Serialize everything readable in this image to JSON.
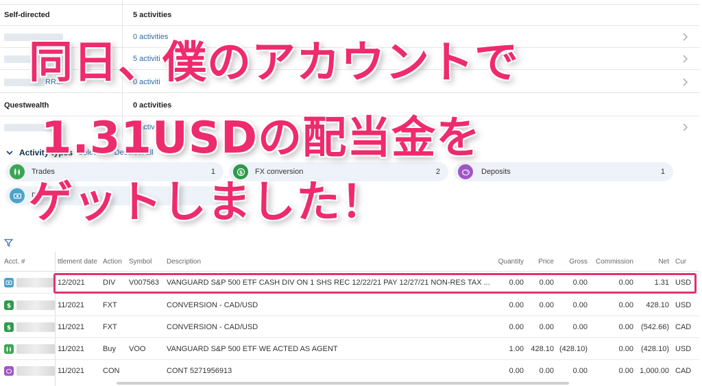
{
  "accounts": {
    "groups": [
      {
        "name": "Self-directed",
        "summary": "5 activities"
      },
      {
        "name": "Questwealth",
        "summary": "0 activities"
      }
    ],
    "sub_rows": [
      {
        "label_suffix": "",
        "summary": "0 activities"
      },
      {
        "label_suffix": "",
        "summary": "5 activiti"
      },
      {
        "label_suffix": "RRSP",
        "summary": "0 activiti"
      },
      {
        "label_suffix": "",
        "summary": "0 activiti"
      }
    ]
  },
  "activity_types": {
    "title": "Activity types",
    "select_all": "Select all",
    "deselect_all": "Deselect all",
    "chips": [
      {
        "label": "Trades",
        "count": "1",
        "icon": "candlestick-icon",
        "color": "#3aa655"
      },
      {
        "label": "FX conversion",
        "count": "2",
        "icon": "dollar-exchange-icon",
        "color": "#2e9a4a"
      },
      {
        "label": "Deposits",
        "count": "1",
        "icon": "piggy-bank-icon",
        "color": "#a056c5"
      },
      {
        "label": "D",
        "count": "",
        "icon": "dividend-icon",
        "color": "#4ba3c9"
      }
    ]
  },
  "table": {
    "columns": {
      "acct": "Acct. #",
      "settlement": "ttlement date",
      "action": "Action",
      "symbol": "Symbol",
      "description": "Description",
      "quantity": "Quantity",
      "price": "Price",
      "gross": "Gross",
      "commission": "Commission",
      "net": "Net",
      "cur": "Cur"
    },
    "rows": [
      {
        "icon": "dividend-icon",
        "icon_color": "#4ba3c9",
        "date": "12/2021",
        "action": "DIV",
        "symbol": "V007563",
        "description": "VANGUARD S&P 500 ETF CASH DIV ON 1 SHS REC 12/22/21 PAY 12/27/21 NON-RES TAX ...",
        "quantity": "0.00",
        "price": "0.00",
        "gross": "0.00",
        "commission": "0.00",
        "net": "1.31",
        "cur": "USD"
      },
      {
        "icon": "dollar-exchange-icon",
        "icon_color": "#2e9a4a",
        "date": "11/2021",
        "action": "FXT",
        "symbol": "",
        "description": "CONVERSION - CAD/USD",
        "quantity": "0.00",
        "price": "0.00",
        "gross": "0.00",
        "commission": "0.00",
        "net": "428.10",
        "cur": "USD"
      },
      {
        "icon": "dollar-exchange-icon",
        "icon_color": "#2e9a4a",
        "date": "11/2021",
        "action": "FXT",
        "symbol": "",
        "description": "CONVERSION - CAD/USD",
        "quantity": "0.00",
        "price": "0.00",
        "gross": "0.00",
        "commission": "0.00",
        "net": "(542.66)",
        "cur": "CAD"
      },
      {
        "icon": "candlestick-icon",
        "icon_color": "#3aa655",
        "date": "11/2021",
        "action": "Buy",
        "symbol": "VOO",
        "description": "VANGUARD S&P 500 ETF WE ACTED AS AGENT",
        "quantity": "1.00",
        "price": "428.10",
        "gross": "(428.10)",
        "commission": "0.00",
        "net": "(428.10)",
        "cur": "USD"
      },
      {
        "icon": "piggy-bank-icon",
        "icon_color": "#a056c5",
        "date": "11/2021",
        "action": "CON",
        "symbol": "",
        "description": "CONT 5271956913",
        "quantity": "0.00",
        "price": "0.00",
        "gross": "0.00",
        "commission": "0.00",
        "net": "1,000.00",
        "cur": "CAD"
      }
    ]
  },
  "overlay": {
    "line1": "同日、僕のアカウントで",
    "line2": "1.31USDの配当金を",
    "line3": "ゲットしました！"
  }
}
